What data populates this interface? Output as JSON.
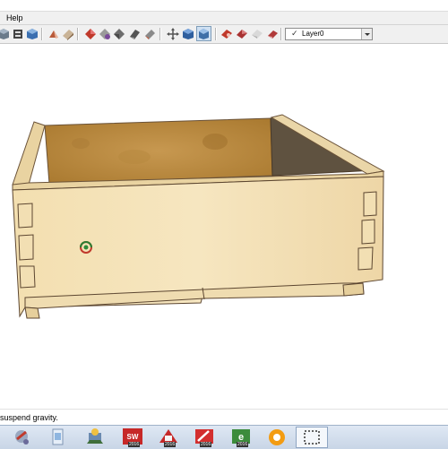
{
  "menu": {
    "help_label": "Help"
  },
  "toolbar": {
    "layer": {
      "check": "✓",
      "value": "Layer0"
    },
    "icons": [
      "cube-icon",
      "wireframe-icon",
      "hidden-line-icon",
      "shaded-icon",
      "material-icon",
      "paint-icon",
      "section-icon",
      "section-fill-icon",
      "xray-icon",
      "back-edges-icon",
      "move-icon",
      "orbit-icon",
      "display-face-icon",
      "warehouse-icon",
      "components-icon",
      "materials-icon",
      "styles-icon"
    ]
  },
  "status": {
    "text": "suspend gravity."
  },
  "taskbar": {
    "apps": [
      {
        "name": "sketchup-icon",
        "badge": ""
      },
      {
        "name": "document-icon",
        "badge": ""
      },
      {
        "name": "network-icon",
        "badge": ""
      },
      {
        "name": "solidworks-icon",
        "badge": "2016"
      },
      {
        "name": "solidworks-explorer-icon",
        "badge": "2016"
      },
      {
        "name": "solidworks-tool-icon",
        "badge": "2016"
      },
      {
        "name": "edrawings-icon",
        "badge": "2016"
      },
      {
        "name": "settings-gear-icon",
        "badge": ""
      },
      {
        "name": "selection-icon",
        "badge": ""
      }
    ]
  },
  "colors": {
    "wood_front": "#f0d9a8",
    "wood_interior": "#b7883f",
    "wood_edge": "#5c4630",
    "taskbar": "#d3deec"
  }
}
